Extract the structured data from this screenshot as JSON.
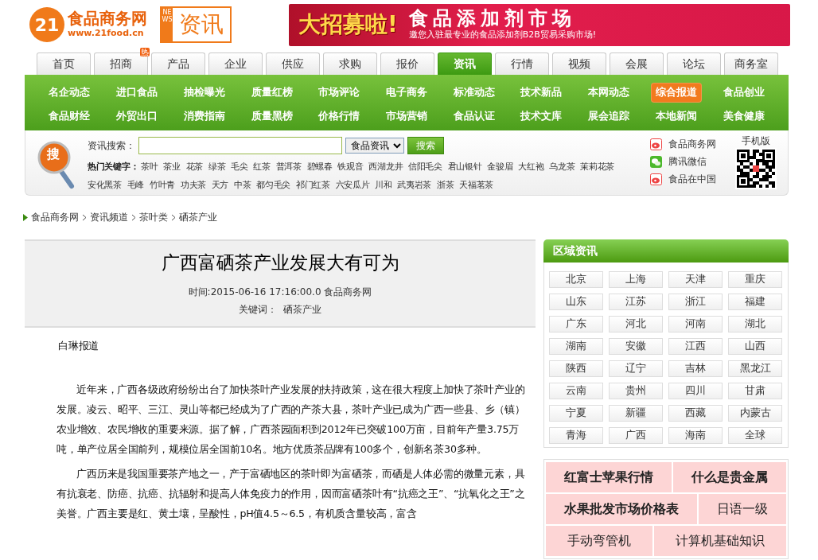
{
  "logo": {
    "number": "21",
    "name": "食品商务网",
    "url": "www.21food.cn"
  },
  "channel": {
    "tag": "NEWS",
    "name": "资讯"
  },
  "banner": {
    "headline": "大招募啦!",
    "title": "食品添加剂市场",
    "subtitle": "邀您入驻最专业的食品添加剂B2B贸易采购市场!"
  },
  "tabs": [
    {
      "label": "首页",
      "selected": false
    },
    {
      "label": "招商",
      "selected": false,
      "badge": "热"
    },
    {
      "label": "产品",
      "selected": false
    },
    {
      "label": "企业",
      "selected": false
    },
    {
      "label": "供应",
      "selected": false
    },
    {
      "label": "求购",
      "selected": false
    },
    {
      "label": "报价",
      "selected": false
    },
    {
      "label": "资讯",
      "selected": true
    },
    {
      "label": "行情",
      "selected": false
    },
    {
      "label": "视频",
      "selected": false
    },
    {
      "label": "会展",
      "selected": false
    },
    {
      "label": "论坛",
      "selected": false
    },
    {
      "label": "商务室",
      "selected": false
    }
  ],
  "subnav": [
    {
      "label": "名企动态",
      "selected": false
    },
    {
      "label": "进口食品",
      "selected": false
    },
    {
      "label": "抽检曝光",
      "selected": false
    },
    {
      "label": "质量红榜",
      "selected": false
    },
    {
      "label": "市场评论",
      "selected": false
    },
    {
      "label": "电子商务",
      "selected": false
    },
    {
      "label": "标准动态",
      "selected": false
    },
    {
      "label": "技术新品",
      "selected": false
    },
    {
      "label": "本网动态",
      "selected": false
    },
    {
      "label": "综合报道",
      "selected": true
    },
    {
      "label": "食品创业",
      "selected": false
    },
    {
      "label": "食品财经",
      "selected": false
    },
    {
      "label": "外贸出口",
      "selected": false
    },
    {
      "label": "消费指南",
      "selected": false
    },
    {
      "label": "质量黑榜",
      "selected": false
    },
    {
      "label": "价格行情",
      "selected": false
    },
    {
      "label": "市场营销",
      "selected": false
    },
    {
      "label": "食品认证",
      "selected": false
    },
    {
      "label": "技术文库",
      "selected": false
    },
    {
      "label": "展会追踪",
      "selected": false
    },
    {
      "label": "本地新闻",
      "selected": false
    },
    {
      "label": "美食健康",
      "selected": false
    }
  ],
  "search": {
    "icon_text": "搜",
    "label": "资讯搜索：",
    "scope": "食品资讯",
    "button": "搜索",
    "hot_label": "热门关键字：",
    "keywords": [
      "茶叶",
      "茶业",
      "花茶",
      "绿茶",
      "毛尖",
      "红茶",
      "普洱茶",
      "碧螺春",
      "铁观音",
      "西湖龙井",
      "信阳毛尖",
      "君山银针",
      "金骏眉",
      "大红袍",
      "乌龙茶",
      "茉莉花茶",
      "安化黑茶",
      "毛峰",
      "竹叶青",
      "功夫茶",
      "天方",
      "中茶",
      "都匀毛尖",
      "祁门红茶",
      "六安瓜片",
      "川和",
      "武夷岩茶",
      "浙茶",
      "天福茗茶"
    ]
  },
  "follow": [
    {
      "kind": "weibo",
      "label": "食品商务网"
    },
    {
      "kind": "wechat",
      "label": "腾讯微信"
    },
    {
      "kind": "weibo",
      "label": "食品在中国"
    }
  ],
  "mobile": {
    "label": "手机版"
  },
  "breadcrumb": [
    "食品商务网",
    "资讯频道",
    "茶叶类",
    "硒茶产业"
  ],
  "article": {
    "title": "广西富硒茶产业发展大有可为",
    "meta": "时间:2015-06-16 17:16:00.0 食品商务网",
    "keywords_label": "关键词：",
    "keywords": "硒茶产业",
    "byline": "白琳报道",
    "paragraphs": [
      "近年来，广西各级政府纷纷出台了加快茶叶产业发展的扶持政策，这在很大程度上加快了茶叶产业的发展。凌云、昭平、三江、灵山等都已经成为了广西的产茶大县，茶叶产业已成为广西一些县、乡（镇）农业增效、农民增收的重要来源。据了解，广西茶园面积到2012年已突破100万亩，目前年产量3.75万吨，单产位居全国前列，规模位居全国前10名。地方优质茶品牌有100多个，创新名茶30多种。",
      "广西历来是我国重要茶产地之一，产于富硒地区的茶叶即为富硒茶，而硒是人体必需的微量元素，具有抗衰老、防癌、抗癌、抗辐射和提高人体免疫力的作用，因而富硒茶叶有“抗癌之王”、“抗氧化之王”之美誉。广西主要是红、黄土壤，呈酸性，pH值4.5～6.5，有机质含量较高，富含"
    ]
  },
  "regions": {
    "title": "区域资讯",
    "items": [
      "北京",
      "上海",
      "天津",
      "重庆",
      "山东",
      "江苏",
      "浙江",
      "福建",
      "广东",
      "河北",
      "河南",
      "湖北",
      "湖南",
      "安徽",
      "江西",
      "山西",
      "陕西",
      "辽宁",
      "吉林",
      "黑龙江",
      "云南",
      "贵州",
      "四川",
      "甘肃",
      "宁夏",
      "新疆",
      "西藏",
      "内蒙古",
      "青海",
      "广西",
      "海南",
      "全球"
    ]
  },
  "promo": [
    [
      {
        "label": "红富士苹果行情",
        "bold": true
      },
      {
        "label": "什么是贵金属",
        "bold": true
      }
    ],
    [
      {
        "label": "水果批发市场价格表",
        "bold": true
      },
      {
        "label": "日语一级",
        "bold": false
      }
    ],
    [
      {
        "label": "手动弯管机",
        "bold": false
      },
      {
        "label": "计算机基础知识",
        "bold": false
      }
    ]
  ]
}
